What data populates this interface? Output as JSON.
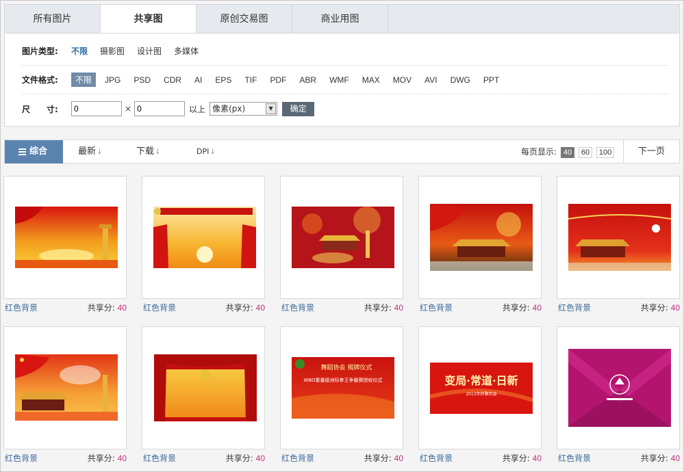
{
  "tabs": [
    "所有图片",
    "共享图",
    "原创交易图",
    "商业用图"
  ],
  "filters": {
    "type_label": "图片类型:",
    "types": [
      "不限",
      "摄影图",
      "设计图",
      "多媒体"
    ],
    "format_label": "文件格式:",
    "formats": [
      "不限",
      "JPG",
      "PSD",
      "CDR",
      "AI",
      "EPS",
      "TIF",
      "PDF",
      "ABR",
      "WMF",
      "MAX",
      "MOV",
      "AVI",
      "DWG",
      "PPT"
    ],
    "size_label": "尺　　寸:",
    "width_value": "0",
    "height_value": "0",
    "times": "×",
    "above": "以上",
    "unit": "像素(px)",
    "confirm": "确定"
  },
  "sortbar": {
    "all": "综合",
    "newest": "最新",
    "downloads": "下载",
    "dpi": "DPI",
    "per_page_label": "每页显示:",
    "per_page_options": [
      "40",
      "60",
      "100"
    ],
    "next_page": "下一页"
  },
  "items": [
    {
      "name": "红色背景",
      "score_label": "共享分:",
      "score": "40"
    },
    {
      "name": "红色背景",
      "score_label": "共享分:",
      "score": "40"
    },
    {
      "name": "红色背景",
      "score_label": "共享分:",
      "score": "40"
    },
    {
      "name": "红色背景",
      "score_label": "共享分:",
      "score": "40"
    },
    {
      "name": "红色背景",
      "score_label": "共享分:",
      "score": "40"
    },
    {
      "name": "红色背景",
      "score_label": "共享分:",
      "score": "40"
    },
    {
      "name": "红色背景",
      "score_label": "共享分:",
      "score": "40"
    },
    {
      "name": "红色背景",
      "score_label": "共享分:",
      "score": "40"
    },
    {
      "name": "红色背景",
      "score_label": "共享分:",
      "score": "40"
    },
    {
      "name": "红色背景",
      "score_label": "共享分:",
      "score": "40"
    }
  ],
  "thumb_texts": {
    "t8_line1": "舞蹈协会 揭牌仪式",
    "t8_line2": "WBO重量级洲际拳王争霸赛授权仪式",
    "t9_title": "变局·常道·日新",
    "t9_sub": "2013年终聚欢会"
  },
  "colors": {
    "accent": "#5b83b0",
    "format_selected": "#6f8ca8",
    "score": "#c0307e",
    "link": "#3b6a9a"
  }
}
